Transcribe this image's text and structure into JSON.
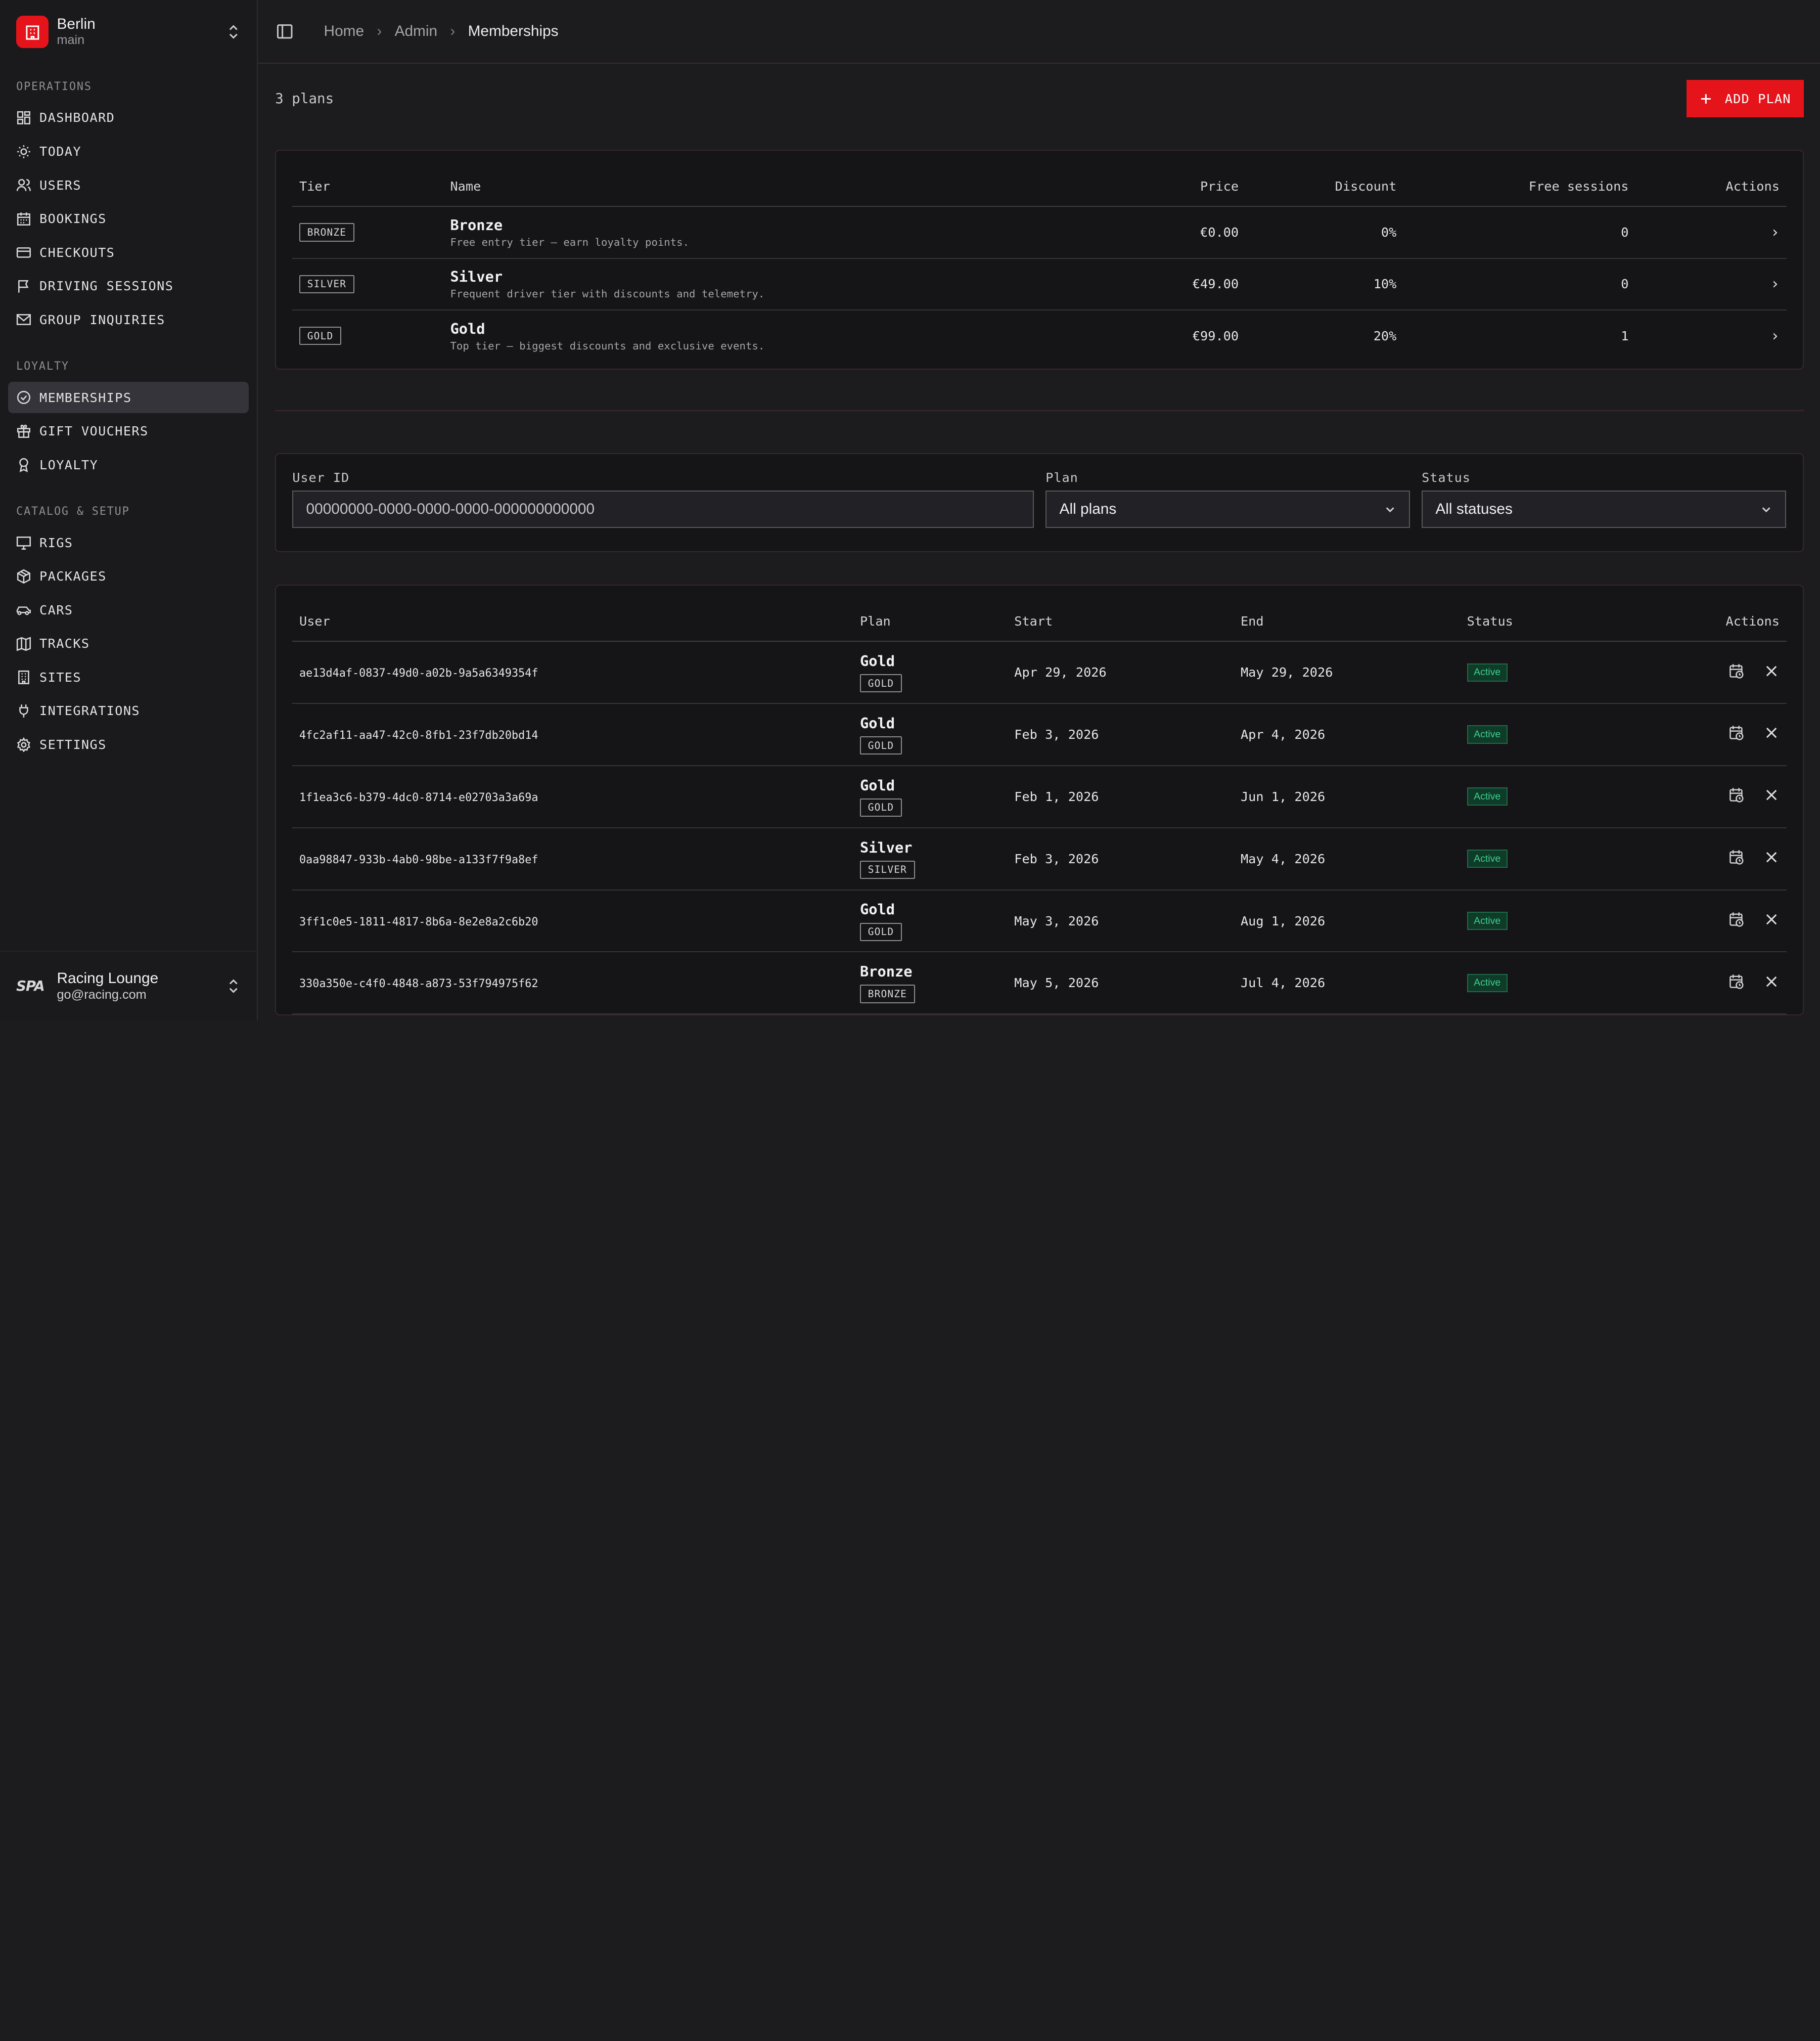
{
  "org": {
    "name": "Berlin",
    "sub": "main"
  },
  "nav_groups": [
    {
      "label": "OPERATIONS",
      "items": [
        "DASHBOARD",
        "TODAY",
        "USERS",
        "BOOKINGS",
        "CHECKOUTS",
        "DRIVING SESSIONS",
        "GROUP INQUIRIES"
      ]
    },
    {
      "label": "LOYALTY",
      "items": [
        "MEMBERSHIPS",
        "GIFT VOUCHERS",
        "LOYALTY"
      ]
    },
    {
      "label": "CATALOG & SETUP",
      "items": [
        "RIGS",
        "PACKAGES",
        "CARS",
        "TRACKS",
        "SITES",
        "INTEGRATIONS",
        "SETTINGS"
      ]
    }
  ],
  "user": {
    "logo": "SPA",
    "name": "Racing Lounge",
    "email": "go@racing.com"
  },
  "breadcrumb": [
    "Home",
    "Admin",
    "Memberships"
  ],
  "plans_count": "3 plans",
  "add_plan_label": "ADD PLAN",
  "plans_table": {
    "headers": [
      "Tier",
      "Name",
      "Price",
      "Discount",
      "Free sessions",
      "Actions"
    ],
    "rows": [
      {
        "tier": "BRONZE",
        "name": "Bronze",
        "desc": "Free entry tier — earn loyalty points.",
        "price": "€0.00",
        "discount": "0%",
        "free": "0"
      },
      {
        "tier": "SILVER",
        "name": "Silver",
        "desc": "Frequent driver tier with discounts and telemetry.",
        "price": "€49.00",
        "discount": "10%",
        "free": "0"
      },
      {
        "tier": "GOLD",
        "name": "Gold",
        "desc": "Top tier — biggest discounts and exclusive events.",
        "price": "€99.00",
        "discount": "20%",
        "free": "1"
      }
    ]
  },
  "filters": {
    "user_id": {
      "label": "User ID",
      "placeholder": "00000000-0000-0000-0000-000000000000"
    },
    "plan": {
      "label": "Plan",
      "value": "All plans"
    },
    "status": {
      "label": "Status",
      "value": "All statuses"
    }
  },
  "members_table": {
    "headers": [
      "User",
      "Plan",
      "Start",
      "End",
      "Status",
      "Actions"
    ],
    "rows": [
      {
        "user": "ae13d4af-0837-49d0-a02b-9a5a6349354f",
        "plan": "Gold",
        "tier": "GOLD",
        "start": "Apr 29, 2026",
        "end": "May 29, 2026",
        "status": "Active"
      },
      {
        "user": "4fc2af11-aa47-42c0-8fb1-23f7db20bd14",
        "plan": "Gold",
        "tier": "GOLD",
        "start": "Feb 3, 2026",
        "end": "Apr 4, 2026",
        "status": "Active"
      },
      {
        "user": "1f1ea3c6-b379-4dc0-8714-e02703a3a69a",
        "plan": "Gold",
        "tier": "GOLD",
        "start": "Feb 1, 2026",
        "end": "Jun 1, 2026",
        "status": "Active"
      },
      {
        "user": "0aa98847-933b-4ab0-98be-a133f7f9a8ef",
        "plan": "Silver",
        "tier": "SILVER",
        "start": "Feb 3, 2026",
        "end": "May 4, 2026",
        "status": "Active"
      },
      {
        "user": "3ff1c0e5-1811-4817-8b6a-8e2e8a2c6b20",
        "plan": "Gold",
        "tier": "GOLD",
        "start": "May 3, 2026",
        "end": "Aug 1, 2026",
        "status": "Active"
      },
      {
        "user": "330a350e-c4f0-4848-a873-53f794975f62",
        "plan": "Bronze",
        "tier": "BRONZE",
        "start": "May 5, 2026",
        "end": "Jul 4, 2026",
        "status": "Active"
      }
    ]
  },
  "colors": {
    "accent": "#e5141a",
    "status_active": "#3fd08c"
  }
}
